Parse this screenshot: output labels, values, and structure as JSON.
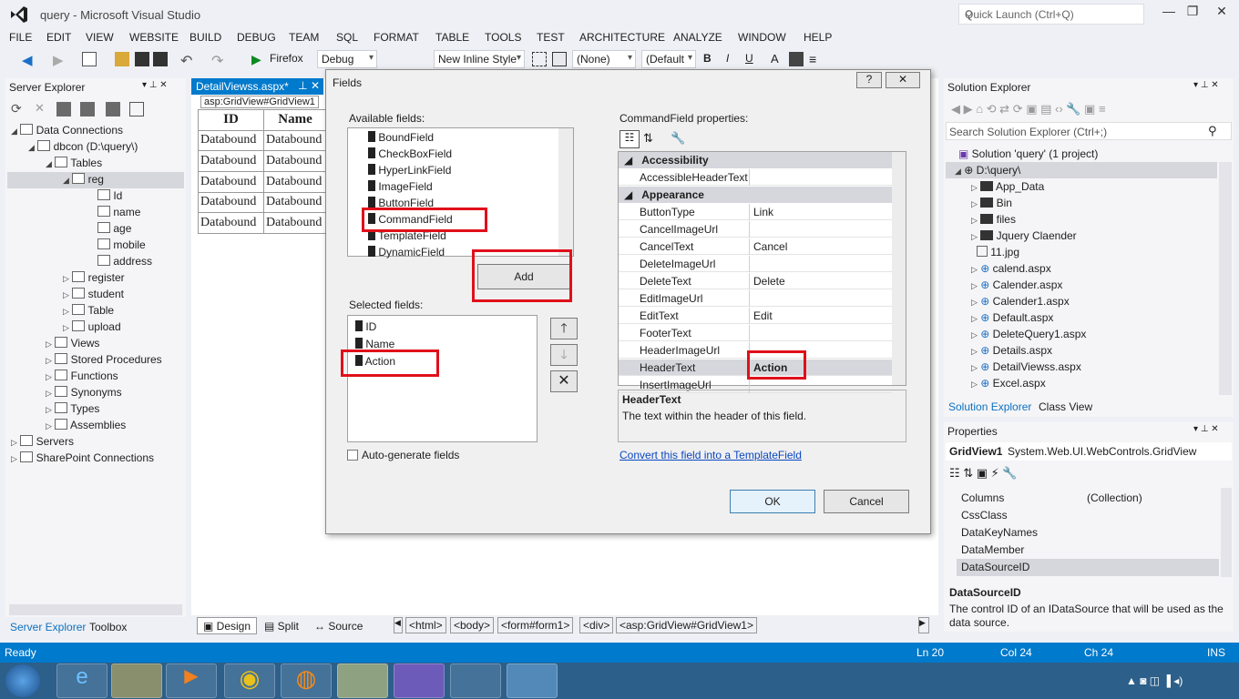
{
  "window": {
    "title": "query - Microsoft Visual Studio",
    "quick_launch_placeholder": "Quick Launch (Ctrl+Q)"
  },
  "menu": [
    "FILE",
    "EDIT",
    "VIEW",
    "WEBSITE",
    "BUILD",
    "DEBUG",
    "TEAM",
    "SQL",
    "FORMAT",
    "TABLE",
    "TOOLS",
    "TEST",
    "ARCHITECTURE",
    "ANALYZE",
    "WINDOW",
    "HELP"
  ],
  "toolbar": {
    "browser": "Firefox",
    "config": "Debug",
    "style": "New Inline Style",
    "none": "(None)",
    "default_font": "(Default",
    "bold": "B",
    "italic": "I",
    "underline": "U",
    "font_color": "A"
  },
  "server_explorer": {
    "title": "Server Explorer",
    "items": [
      {
        "label": "Data Connections",
        "indent": 0,
        "arrow": "◢"
      },
      {
        "label": "dbcon (D:\\query\\)",
        "indent": 1,
        "arrow": "◢"
      },
      {
        "label": "Tables",
        "indent": 2,
        "arrow": "◢"
      },
      {
        "label": "reg",
        "indent": 3,
        "arrow": "◢"
      },
      {
        "label": "Id",
        "indent": 5,
        "arrow": ""
      },
      {
        "label": "name",
        "indent": 5,
        "arrow": ""
      },
      {
        "label": "age",
        "indent": 5,
        "arrow": ""
      },
      {
        "label": "mobile",
        "indent": 5,
        "arrow": ""
      },
      {
        "label": "address",
        "indent": 5,
        "arrow": ""
      },
      {
        "label": "register",
        "indent": 3,
        "arrow": "▷"
      },
      {
        "label": "student",
        "indent": 3,
        "arrow": "▷"
      },
      {
        "label": "Table",
        "indent": 3,
        "arrow": "▷"
      },
      {
        "label": "upload",
        "indent": 3,
        "arrow": "▷"
      },
      {
        "label": "Views",
        "indent": 2,
        "arrow": "▷"
      },
      {
        "label": "Stored Procedures",
        "indent": 2,
        "arrow": "▷"
      },
      {
        "label": "Functions",
        "indent": 2,
        "arrow": "▷"
      },
      {
        "label": "Synonyms",
        "indent": 2,
        "arrow": "▷"
      },
      {
        "label": "Types",
        "indent": 2,
        "arrow": "▷"
      },
      {
        "label": "Assemblies",
        "indent": 2,
        "arrow": "▷"
      },
      {
        "label": "Servers",
        "indent": 0,
        "arrow": "▷"
      },
      {
        "label": "SharePoint Connections",
        "indent": 0,
        "arrow": "▷"
      }
    ],
    "bottom_tabs": [
      "Server Explorer",
      "Toolbox"
    ]
  },
  "editor": {
    "tab": "DetailViewss.aspx*",
    "tag": "asp:GridView#GridView1",
    "grid_headers": [
      "ID",
      "Name"
    ],
    "grid_cell": "Databound",
    "grid_cell2": "Databound"
  },
  "designer_bar": {
    "design": "Design",
    "split": "Split",
    "source": "Source",
    "crumbs": [
      "<html>",
      "<body>",
      "<form#form1>",
      "<div>",
      "<asp:GridView#GridView1>"
    ]
  },
  "dialog": {
    "title": "Fields",
    "help": "?",
    "close": "✕",
    "available_label": "Available fields:",
    "available": [
      "BoundField",
      "CheckBoxField",
      "HyperLinkField",
      "ImageField",
      "ButtonField",
      "CommandField",
      "TemplateField",
      "DynamicField"
    ],
    "add": "Add",
    "selected_label": "Selected fields:",
    "selected": [
      "ID",
      "Name",
      "Action"
    ],
    "autogen": "Auto-generate fields",
    "props_label": "CommandField properties:",
    "props": [
      {
        "name": "Accessibility",
        "value": "",
        "cat": true
      },
      {
        "name": "AccessibleHeaderText",
        "value": ""
      },
      {
        "name": "Appearance",
        "value": "",
        "cat": true
      },
      {
        "name": "ButtonType",
        "value": "Link"
      },
      {
        "name": "CancelImageUrl",
        "value": ""
      },
      {
        "name": "CancelText",
        "value": "Cancel"
      },
      {
        "name": "DeleteImageUrl",
        "value": ""
      },
      {
        "name": "DeleteText",
        "value": "Delete"
      },
      {
        "name": "EditImageUrl",
        "value": ""
      },
      {
        "name": "EditText",
        "value": "Edit"
      },
      {
        "name": "FooterText",
        "value": ""
      },
      {
        "name": "HeaderImageUrl",
        "value": ""
      },
      {
        "name": "HeaderText",
        "value": "Action"
      },
      {
        "name": "InsertImageUrl",
        "value": ""
      }
    ],
    "desc_title": "HeaderText",
    "desc_text": "The text within the header of this field.",
    "convert_link": "Convert this field into a TemplateField",
    "ok": "OK",
    "cancel": "Cancel"
  },
  "solution": {
    "title": "Solution Explorer",
    "search": "Search Solution Explorer (Ctrl+;)",
    "root": "Solution 'query' (1 project)",
    "project": "D:\\query\\",
    "items": [
      "App_Data",
      "Bin",
      "files",
      "Jquery Claender",
      "11.jpg",
      "calend.aspx",
      "Calender.aspx",
      "Calender1.aspx",
      "Default.aspx",
      "DeleteQuery1.aspx",
      "Details.aspx",
      "DetailViewss.aspx",
      "Excel.aspx"
    ],
    "tabs": [
      "Solution Explorer",
      "Class View"
    ]
  },
  "properties": {
    "title": "Properties",
    "object": "GridView1",
    "type": "System.Web.UI.WebControls.GridView",
    "rows": [
      {
        "name": "Columns",
        "value": "(Collection)"
      },
      {
        "name": "CssClass",
        "value": ""
      },
      {
        "name": "DataKeyNames",
        "value": ""
      },
      {
        "name": "DataMember",
        "value": ""
      },
      {
        "name": "DataSourceID",
        "value": ""
      }
    ],
    "desc_title": "DataSourceID",
    "desc_text": "The control ID of an IDataSource that will be used as the data source."
  },
  "status": {
    "ready": "Ready",
    "ln": "Ln 20",
    "col": "Col 24",
    "ch": "Ch 24",
    "ins": "INS"
  }
}
